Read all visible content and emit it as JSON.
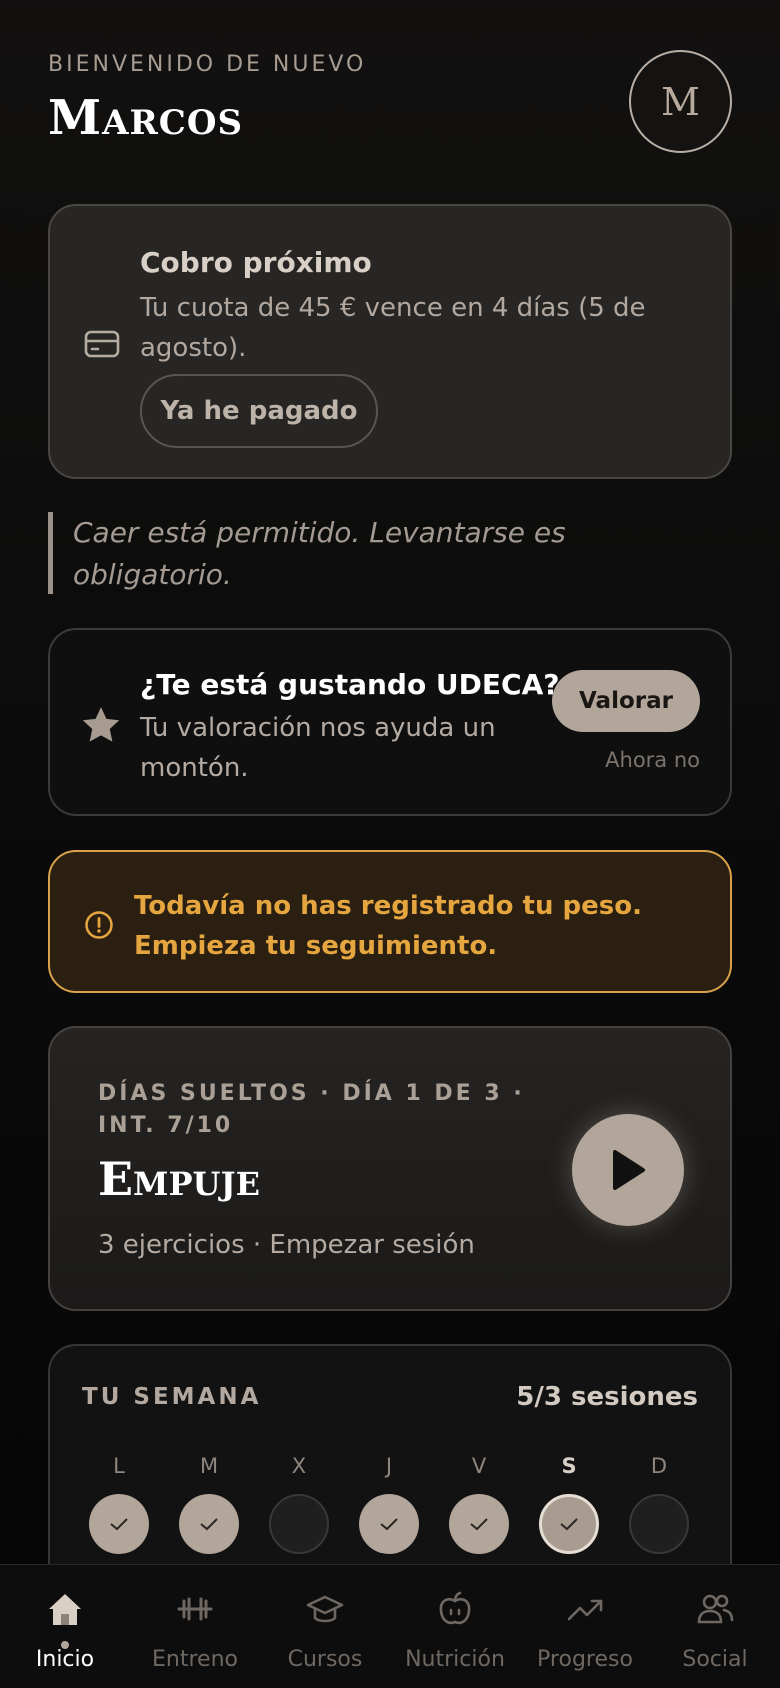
{
  "header": {
    "welcome": "BIENVENIDO DE NUEVO",
    "username": "Marcos",
    "avatar_initial": "M"
  },
  "billing": {
    "title": "Cobro próximo",
    "text": "Tu cuota de 45 € vence en 4 días (5 de agosto).",
    "button": "Ya he pagado",
    "icon": "credit-card-icon"
  },
  "quote": "Caer está permitido. Levantarse es obligatorio.",
  "rating": {
    "title": "¿Te está gustando UDECA?",
    "text": "Tu valoración nos ayuda un montón.",
    "button": "Valorar",
    "dismiss": "Ahora no",
    "icon": "star-icon"
  },
  "warning": {
    "text": "Todavía no has registrado tu peso. Empieza tu seguimiento.",
    "icon": "alert-circle-icon",
    "color": "#e5a640"
  },
  "session": {
    "meta": "DÍAS SUELTOS · DÍA 1 DE 3 · INT. 7/10",
    "name": "Empuje",
    "sub": "3 ejercicios · Empezar sesión",
    "icon": "play-icon"
  },
  "week": {
    "title": "TU SEMANA",
    "count": "5/3 sesiones",
    "days": [
      {
        "letter": "L",
        "state": "done"
      },
      {
        "letter": "M",
        "state": "done"
      },
      {
        "letter": "X",
        "state": "empty"
      },
      {
        "letter": "J",
        "state": "done"
      },
      {
        "letter": "V",
        "state": "done"
      },
      {
        "letter": "S",
        "state": "today"
      },
      {
        "letter": "D",
        "state": "empty"
      }
    ]
  },
  "nav": {
    "items": [
      {
        "label": "Inicio",
        "icon": "home-icon",
        "active": true
      },
      {
        "label": "Entreno",
        "icon": "dumbbell-icon",
        "active": false
      },
      {
        "label": "Cursos",
        "icon": "graduation-cap-icon",
        "active": false
      },
      {
        "label": "Nutrición",
        "icon": "apple-icon",
        "active": false
      },
      {
        "label": "Progreso",
        "icon": "trending-up-icon",
        "active": false
      },
      {
        "label": "Social",
        "icon": "users-icon",
        "active": false
      }
    ]
  },
  "colors": {
    "accent": "#b2a59a",
    "background": "#0b0b0b",
    "warning": "#e5a640"
  }
}
